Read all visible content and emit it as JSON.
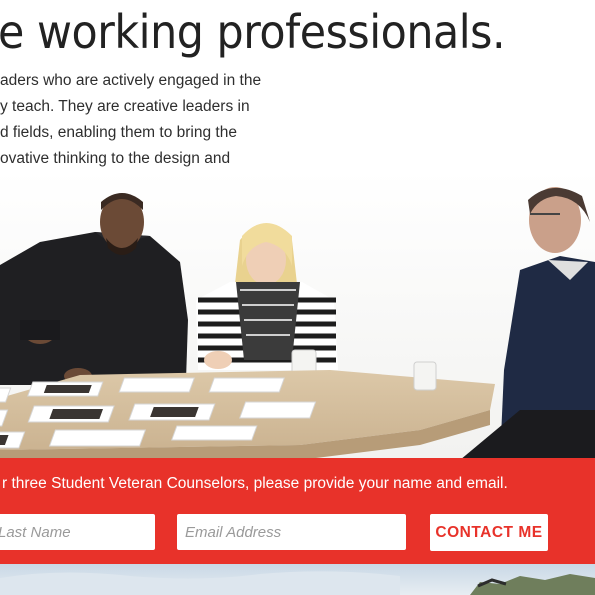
{
  "hero": {
    "headline": "e working professionals.",
    "intro_lines": [
      "aders who are actively engaged in the",
      "y teach. They are creative leaders in",
      "d fields, enabling them to bring the",
      "ovative thinking to the design and"
    ]
  },
  "cta": {
    "text": "r three Student Veteran Counselors, please provide your name and email.",
    "last_name_placeholder": "Last Name",
    "email_placeholder": "Email Address",
    "button_label": "CONTACT ME"
  },
  "colors": {
    "accent": "#e8322a",
    "background": "#ffffff",
    "text": "#2b2b2b"
  },
  "icons": []
}
